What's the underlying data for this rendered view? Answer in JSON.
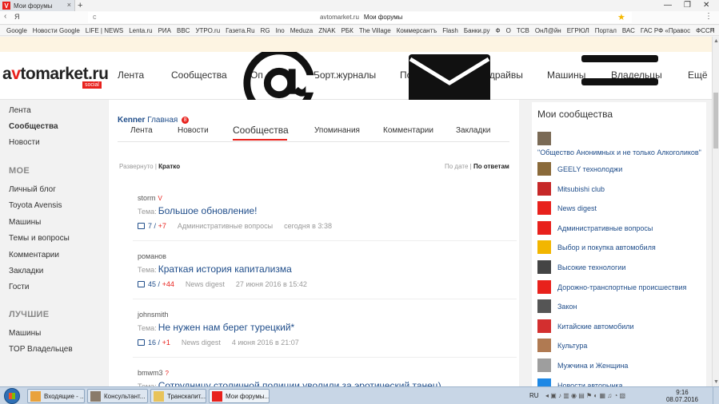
{
  "browser": {
    "tab_title": "Мои форумы",
    "tab_close": "×",
    "new_tab": "+",
    "window_controls": [
      "—",
      "❐",
      "✕"
    ],
    "back": "‹",
    "search_brand": "Я",
    "reload": "c",
    "url_domain": "avtomarket.ru",
    "url_page": "Мои форумы",
    "star": "★",
    "menu": "⋮",
    "bookmarks": [
      "Google",
      "Новости Google",
      "LIFE | NEWS",
      "Lenta.ru",
      "РИА",
      "BBC",
      "УТРО.ru",
      "Газета.Ru",
      "RG",
      "Ino",
      "Meduza",
      "ZNAK",
      "РБК",
      "The Village",
      "Коммерсантъ",
      "Flash",
      "Банки.ру",
      "Ф",
      "О",
      "ТСВ",
      "ОнЛ@йн",
      "ЕГРЮЛ",
      "Портал",
      "ВАС",
      "ГАС РФ «Правос",
      "ФССП"
    ],
    "bookmarks_more": "»"
  },
  "site": {
    "logo_main_a": "a",
    "logo_main_v": "v",
    "logo_main_rest": "tomarket.ru",
    "logo_badge": "social",
    "nav": [
      "Лента",
      "Сообщества",
      "Оп",
      "Борт.журналы",
      "По",
      "Тест-драйвы",
      "Машины",
      "Владельцы",
      "Ещё"
    ],
    "overlay_icons": [
      "at-icon",
      "mail-icon",
      "menu-icon"
    ]
  },
  "left_sidebar": {
    "top_items": [
      "Лента",
      "Сообщества",
      "Новости"
    ],
    "moe_heading": "МОЕ",
    "moe_items": [
      "Личный блог",
      "Toyota Avensis",
      "Машины",
      "Темы и вопросы",
      "Комментарии",
      "Закладки",
      "Гости"
    ],
    "best_heading": "ЛУЧШИЕ",
    "best_items": [
      "Машины",
      "TOP Владельцев"
    ]
  },
  "center": {
    "user_name": "Kenner",
    "user_page": "Главная",
    "user_badge": "8",
    "tabs": [
      "Лента",
      "Новости",
      "Сообщества",
      "Упоминания",
      "Комментарии",
      "Закладки"
    ],
    "active_tab": "Сообщества",
    "view_expanded": "Развернуто",
    "view_sep": "|",
    "view_brief": "Кратко",
    "sort_date": "По дате",
    "sort_answers": "По ответам",
    "topic_label": "Тема:",
    "posts": [
      {
        "author": "storm",
        "badge": "V",
        "title": "Большое обновление!",
        "count": "7",
        "sep": "/",
        "plus": "+7",
        "community": "Административные вопросы",
        "date": "сегодня в 3:38"
      },
      {
        "author": "романов",
        "badge": "",
        "title": "Краткая история капитализма",
        "count": "45",
        "sep": "/",
        "plus": "+44",
        "community": "News digest",
        "date": "27 июня 2016 в 15:42"
      },
      {
        "author": "johnsmith",
        "badge": "",
        "title": "Не нужен нам берег турецкий*",
        "count": "16",
        "sep": "/",
        "plus": "+1",
        "community": "News digest",
        "date": "4 июня 2016 в 21:07"
      },
      {
        "author": "bmwm3",
        "badge": "?",
        "title": "Сотрудницу столичной полиции уволили за эротический танец)",
        "count": "",
        "sep": "",
        "plus": "",
        "community": "",
        "date": ""
      }
    ]
  },
  "right_sidebar": {
    "title": "Мои сообщества",
    "first_wide_label": "\"Общество Анонимных и не только Алкоголиков\"",
    "items": [
      {
        "label": "GEELY технолоджи",
        "color": "#8a6a3a"
      },
      {
        "label": "Mitsubishi club",
        "color": "#c62828"
      },
      {
        "label": "News digest",
        "color": "#e8211c"
      },
      {
        "label": "Административные вопросы",
        "color": "#e8211c"
      },
      {
        "label": "Выбор и покупка автомобиля",
        "color": "#f2b600"
      },
      {
        "label": "Высокие технологии",
        "color": "#444444"
      },
      {
        "label": "Дорожно-транспортные происшествия",
        "color": "#e8211c"
      },
      {
        "label": "Закон",
        "color": "#555555"
      },
      {
        "label": "Китайские автомобили",
        "color": "#d32f2f"
      },
      {
        "label": "Культура",
        "color": "#b07a52"
      },
      {
        "label": "Мужчина и Женщина",
        "color": "#9e9e9e"
      },
      {
        "label": "Новости авторынка",
        "color": "#1e88e5"
      }
    ],
    "first_icon_color": "#7a6a55"
  },
  "taskbar": {
    "tasks": [
      "Входящие - ...",
      "Консультант...",
      "Транскапит...",
      "Мои форумы..."
    ],
    "lang": "RU",
    "time": "9:16",
    "date": "08.07.2016"
  },
  "colors": {
    "accent": "#e8211c",
    "link": "#1f4d8a"
  }
}
